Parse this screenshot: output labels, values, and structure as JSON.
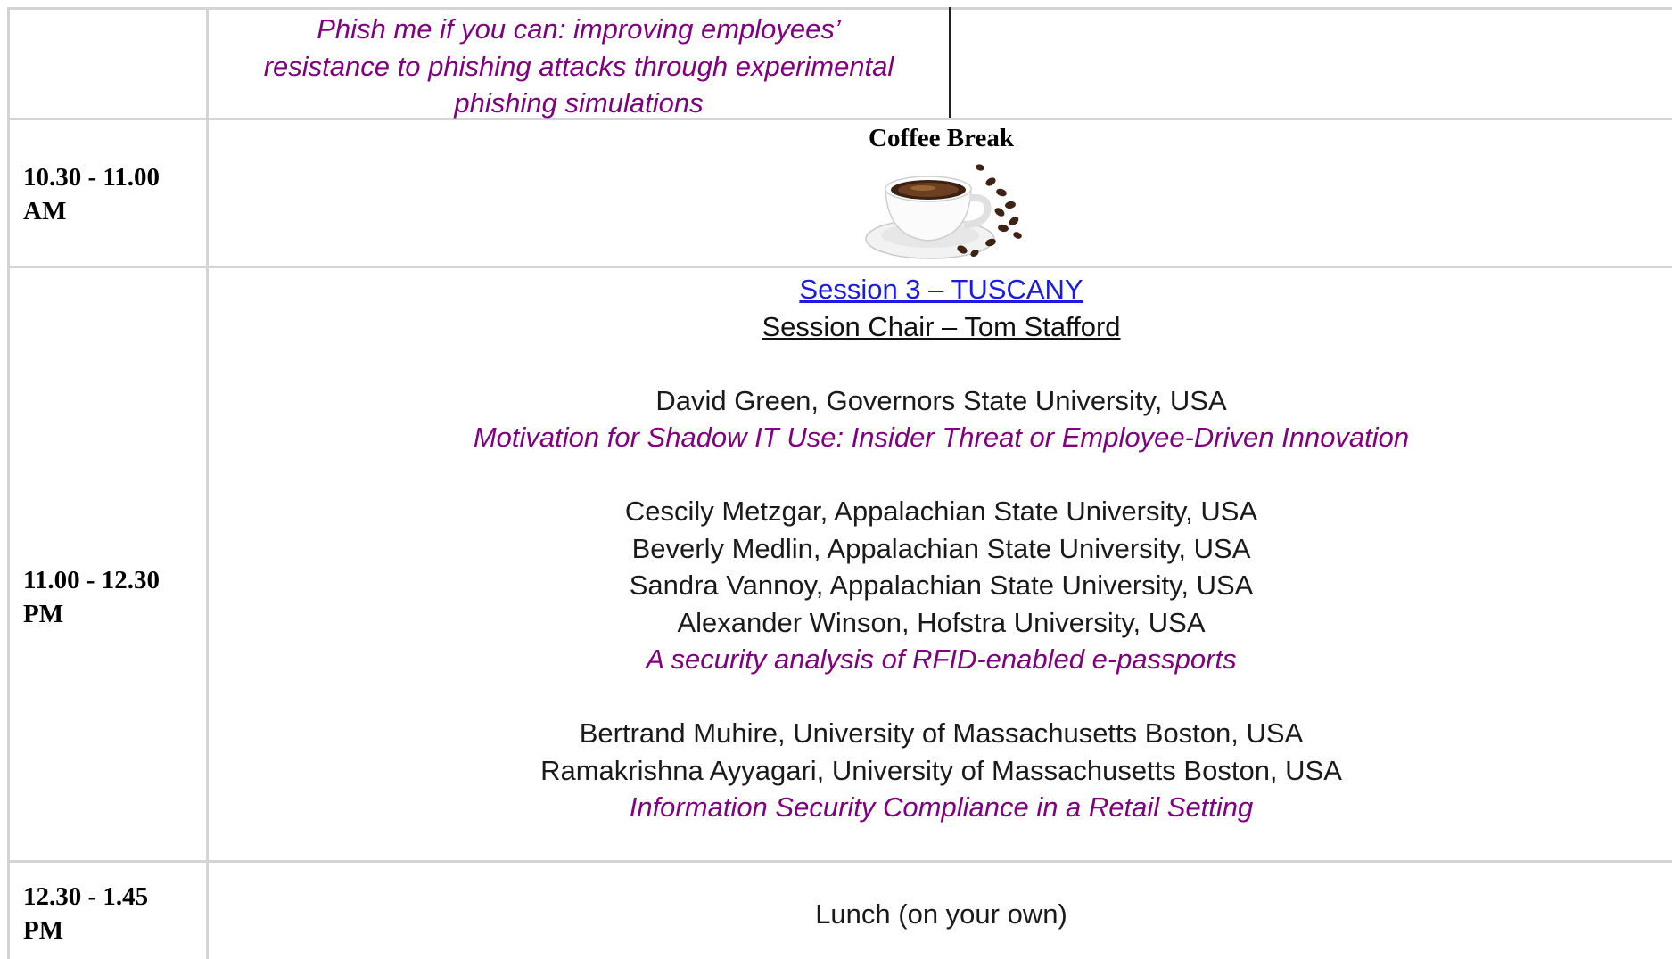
{
  "top_row": {
    "title_lines": [
      "Phish me if you can: improving employees’",
      "resistance to phishing attacks through experimental",
      "phishing simulations"
    ]
  },
  "coffee_row": {
    "time_lines": [
      "10.30 - 11.00",
      "AM"
    ],
    "label": "Coffee Break",
    "image": "coffee-cup-with-beans"
  },
  "session_row": {
    "time_lines": [
      "11.00 - 12.30",
      "PM"
    ],
    "session_link": "Session 3 – TUSCANY",
    "session_chair": "Session Chair – Tom Stafford",
    "papers": [
      {
        "authors": [
          "David Green, Governors State University, USA"
        ],
        "title": "Motivation for Shadow IT Use: Insider Threat or Employee-Driven Innovation"
      },
      {
        "authors": [
          "Cescily Metzgar, Appalachian State University, USA",
          "Beverly Medlin, Appalachian State University, USA",
          "Sandra Vannoy, Appalachian State University, USA",
          "Alexander Winson, Hofstra University, USA"
        ],
        "title": "A security analysis of RFID-enabled e-passports"
      },
      {
        "authors": [
          "Bertrand Muhire, University of Massachusetts Boston, USA",
          "Ramakrishna Ayyagari, University of Massachusetts Boston, USA"
        ],
        "title": "Information Security Compliance in a Retail Setting"
      }
    ]
  },
  "lunch_row": {
    "time_lines": [
      "12.30 - 1.45",
      "PM"
    ],
    "label": "Lunch (on your own)"
  },
  "colors": {
    "title_purple": "#800080",
    "link_blue": "#1a1ae6",
    "grid": "#d4d4d4"
  }
}
